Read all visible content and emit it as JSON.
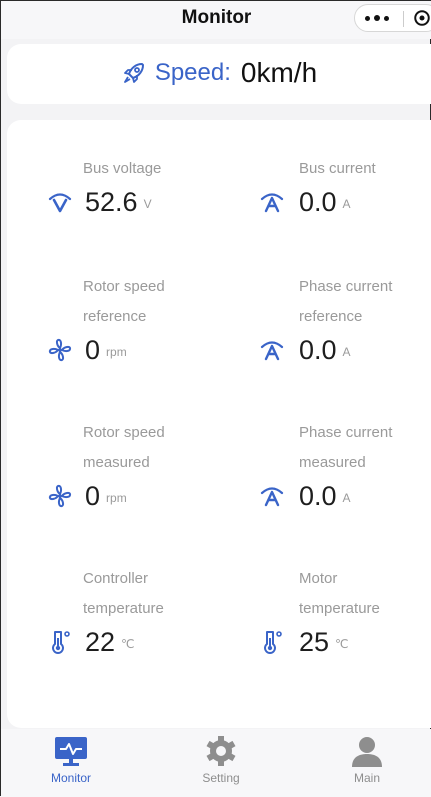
{
  "header": {
    "title": "Monitor"
  },
  "speed": {
    "label": "Speed:",
    "value": "0km/h"
  },
  "metrics": [
    {
      "label": "Bus voltage",
      "value": "52.6",
      "unit": "V",
      "icon": "voltage-icon"
    },
    {
      "label": "Bus current",
      "value": "0.0",
      "unit": "A",
      "icon": "current-icon"
    },
    {
      "label": "Rotor speed reference",
      "value": "0",
      "unit": "rpm",
      "icon": "fan-icon"
    },
    {
      "label": "Phase current reference",
      "value": "0.0",
      "unit": "A",
      "icon": "current-icon"
    },
    {
      "label": "Rotor speed measured",
      "value": "0",
      "unit": "rpm",
      "icon": "fan-icon"
    },
    {
      "label": "Phase current measured",
      "value": "0.0",
      "unit": "A",
      "icon": "current-icon"
    },
    {
      "label": "Controller temperature",
      "value": "22",
      "unit": "℃",
      "icon": "thermometer-icon"
    },
    {
      "label": "Motor temperature",
      "value": "25",
      "unit": "℃",
      "icon": "thermometer-icon"
    }
  ],
  "tabs": [
    {
      "label": "Monitor",
      "icon": "monitor-icon",
      "active": true
    },
    {
      "label": "Setting",
      "icon": "gear-icon",
      "active": false
    },
    {
      "label": "Main",
      "icon": "user-icon",
      "active": false
    }
  ],
  "colors": {
    "accent": "#3a64c8",
    "label": "#9a9a9a",
    "inactive_tab": "#8e8e8e",
    "background": "#f3f3f5"
  }
}
